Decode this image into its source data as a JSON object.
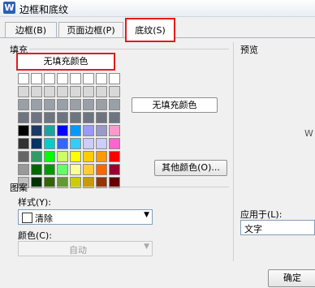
{
  "window": {
    "title": "边框和底纹",
    "icon": "W"
  },
  "tabs": [
    {
      "label": "边框(B)"
    },
    {
      "label": "页面边框(P)"
    },
    {
      "label": "底纹(S)"
    }
  ],
  "fill": {
    "section_label": "填充",
    "no_fill_label": "无填充颜色",
    "selected_label": "无填充颜色",
    "more_colors_button": "其他颜色(O)...",
    "palette": [
      "#ffffff",
      "#ffffff",
      "#ffffff",
      "#ffffff",
      "#ffffff",
      "#ffffff",
      "#ffffff",
      "#ffffff",
      "#d8d8d8",
      "#d8d8d8",
      "#d8d8d8",
      "#d8d8d8",
      "#d8d8d8",
      "#d8d8d8",
      "#d8d8d8",
      "#d8d8d8",
      "#9aa0a8",
      "#9aa0a8",
      "#9aa0a8",
      "#9aa0a8",
      "#9aa0a8",
      "#9aa0a8",
      "#9aa0a8",
      "#9aa0a8",
      "#6e7580",
      "#6e7580",
      "#6e7580",
      "#6e7580",
      "#6e7580",
      "#6e7580",
      "#6e7580",
      "#6e7580",
      "#000000",
      "#1c3a66",
      "#1aa3a3",
      "#0000ff",
      "#0099ff",
      "#9999ff",
      "#9999cc",
      "#ff99cc",
      "#333333",
      "#003366",
      "#00cccc",
      "#3366ff",
      "#33ccff",
      "#ccccff",
      "#ccccff",
      "#ff66cc",
      "#666666",
      "#339966",
      "#00ff00",
      "#ccff66",
      "#ffff00",
      "#ffcc00",
      "#ff9900",
      "#ff0000",
      "#999999",
      "#006600",
      "#009900",
      "#66ff66",
      "#ffff99",
      "#ffcc33",
      "#ff6600",
      "#990033",
      "#c0c0c0",
      "#003300",
      "#336600",
      "#669933",
      "#cccc00",
      "#cc9900",
      "#993300",
      "#660000"
    ]
  },
  "pattern": {
    "section_label": "图案",
    "style_label": "样式(Y):",
    "style_value": "清除",
    "color_label": "颜色(C):",
    "color_value": "自动"
  },
  "preview": {
    "section_label": "预览",
    "sample_char": "W"
  },
  "apply": {
    "label": "应用于(L):",
    "value": "文字"
  },
  "buttons": {
    "ok": "确定"
  },
  "colors": {
    "highlight": "#e51a1a"
  }
}
